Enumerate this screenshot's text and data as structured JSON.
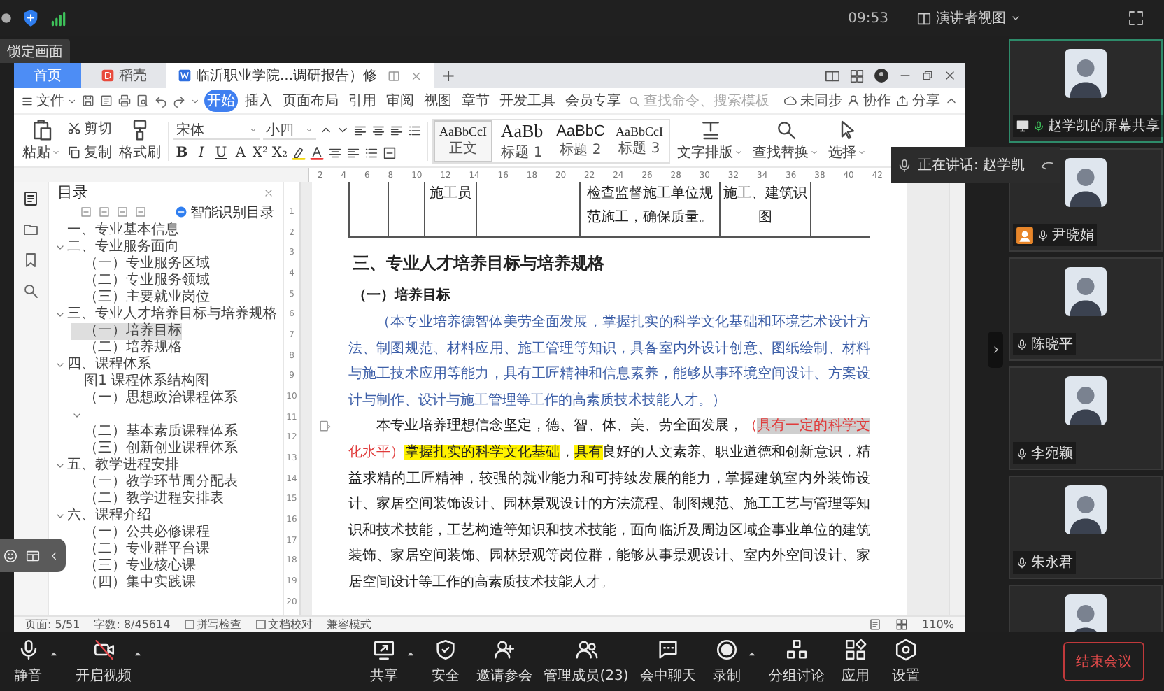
{
  "top_bar": {
    "time": "09:53",
    "view_menu": "演讲者视图"
  },
  "lock_label": "锁定画面",
  "wps": {
    "tabs": [
      {
        "kind": "home",
        "label": "首页",
        "selected": false
      },
      {
        "kind": "docer",
        "label": "稻壳",
        "selected": false
      },
      {
        "kind": "document",
        "label": "临沂职业学院...调研报告）修",
        "selected": true
      }
    ],
    "new_tab": "+",
    "file_menu": "文件",
    "menu_tabs": [
      {
        "label": "开始",
        "selected": true
      },
      {
        "label": "插入",
        "selected": false
      },
      {
        "label": "页面布局",
        "selected": false
      },
      {
        "label": "引用",
        "selected": false
      },
      {
        "label": "审阅",
        "selected": false
      },
      {
        "label": "视图",
        "selected": false
      },
      {
        "label": "章节",
        "selected": false
      },
      {
        "label": "开发工具",
        "selected": false
      },
      {
        "label": "会员专享",
        "selected": false
      }
    ],
    "search": {
      "placeholder": "查找命令、搜索模板"
    },
    "actions": [
      {
        "kind": "sync",
        "label": "未同步"
      },
      {
        "kind": "collab",
        "label": "协作"
      },
      {
        "kind": "share",
        "label": "分享"
      }
    ],
    "ribbon": {
      "clipboard": {
        "paste": "粘贴",
        "cut": "剪切",
        "copy": "复制",
        "format_painter": "格式刷"
      },
      "font": {
        "name": "宋体",
        "size": "小四",
        "glyphs": [
          "B",
          "I",
          "U",
          "A",
          "X²",
          "X₂"
        ]
      },
      "styles": [
        {
          "sample": "AaBbCcI",
          "label": "正文",
          "selected": true
        },
        {
          "sample": "AaBb",
          "label": "标题 1",
          "selected": false
        },
        {
          "sample": "AaBbC",
          "label": "标题 2",
          "selected": false
        },
        {
          "sample": "AaBbCcI",
          "label": "标题 3",
          "selected": false
        }
      ],
      "tools": [
        {
          "kind": "layout",
          "label": "文字排版"
        },
        {
          "kind": "find",
          "label": "查找替换"
        },
        {
          "kind": "select",
          "label": "选择"
        }
      ]
    },
    "ruler": {
      "labels": [
        "2",
        "4",
        "6",
        "8",
        "10",
        "12",
        "14",
        "16",
        "18",
        "20",
        "22",
        "24",
        "26",
        "28",
        "30",
        "32",
        "34",
        "36",
        "38",
        "40",
        "42"
      ]
    },
    "vertical_ruler": {
      "labels": [
        "1",
        "2",
        "3",
        "4",
        "5",
        "6",
        "7",
        "8",
        "9",
        "10",
        "11",
        "12",
        "13",
        "14",
        "15",
        "16",
        "17",
        "18",
        "19",
        "20"
      ]
    },
    "outline": {
      "title": "目录",
      "smart_button": "智能识别目录",
      "items": [
        {
          "label": "一、专业基本信息",
          "selected": false
        },
        {
          "label": "二、专业服务面向",
          "selected": false,
          "expanded": true,
          "children": [
            {
              "label": "（一）专业服务区域",
              "selected": false
            },
            {
              "label": "（二）专业服务领域",
              "selected": false
            },
            {
              "label": "（三）主要就业岗位",
              "selected": false
            }
          ]
        },
        {
          "label": "三、专业人才培养目标与培养规格",
          "selected": false,
          "expanded": true,
          "children": [
            {
              "label": "（一）培养目标",
              "selected": true
            },
            {
              "label": "（二）培养规格",
              "selected": false
            }
          ]
        },
        {
          "label": "四、课程体系",
          "selected": false,
          "expanded": true,
          "children": [
            {
              "label": "图1 课程体系结构图",
              "selected": false
            },
            {
              "label": "（一）思想政治课程体系",
              "selected": false
            },
            {
              "selected": false,
              "expanded": true
            },
            {
              "label": "（二）基本素质课程体系",
              "selected": false
            },
            {
              "label": "（三）创新创业课程体系",
              "selected": false
            }
          ]
        },
        {
          "label": "五、教学进程安排",
          "selected": false,
          "expanded": true,
          "children": [
            {
              "label": "（一）教学环节周分配表",
              "selected": false
            },
            {
              "label": "（二）教学进程安排表",
              "selected": false
            }
          ]
        },
        {
          "label": "六、课程介绍",
          "selected": false,
          "expanded": true,
          "children": [
            {
              "label": "（一）公共必修课程",
              "selected": false
            },
            {
              "label": "（二）专业群平台课",
              "selected": false
            },
            {
              "label": "（三）专业核心课",
              "selected": false
            },
            {
              "label": "（四）集中实践课",
              "selected": false
            }
          ]
        }
      ]
    },
    "document": {
      "table_row": [
        "施工员",
        "检查监督施工单位规范施工，确保质量。",
        "施工、建筑识图"
      ],
      "heading": "三、专业人才培养目标与培养规格",
      "subheading": "（一）培养目标",
      "paragraphs": [
        {
          "runs": [
            {
              "kind": "revision",
              "text": "（本专业培养德智体美劳全面发展，掌握扎实的科学文化基础和环境艺术设计方法、制图规范、材料应用、施工管理等知识，具备室内外设计创意、图纸绘制、材料与施工技术应用等能力，具有工匠精神和信息素养，能够从事环境空间设计、方案设计与制作、设计与施工管理等工作的高素质技术技能人才。）"
            }
          ]
        },
        {
          "runs": [
            {
              "kind": "plain",
              "text": "本专业培养理想信念坚定，德、智、体、美、劳全面发展，"
            },
            {
              "kind": "deleted",
              "text": "（"
            },
            {
              "kind": "deleted_selected",
              "text": "具有一定的科学文"
            },
            {
              "kind": "deleted",
              "text": "化水平）"
            },
            {
              "kind": "highlight",
              "text": "掌握扎实的科学文化基础"
            },
            {
              "kind": "plain",
              "text": "，"
            },
            {
              "kind": "highlight",
              "text": "具有"
            },
            {
              "kind": "plain",
              "text": "良好的人文素养、职业道德和创新意识，精益求精的工匠精神，较强的就业能力和可持续发展的能力，掌握建筑室内外装饰设计、家居空间装饰设计、园林景观设计的方法流程、制图规范、施工工艺与管理等知识和技术技能，工艺构造等知识和技术技能，面向临沂及周边区域企事业单位的建筑装饰、家居空间装饰、园林景观等岗位群，能够从事景观设计、室内外空间设计、家居空间设计等工作的高素质技术技能人才。"
            }
          ]
        }
      ]
    },
    "status_bar": [
      {
        "kind": "text",
        "label": "页面: 5/51"
      },
      {
        "kind": "text",
        "label": "字数: 8/45614"
      },
      {
        "kind": "check",
        "label": "拼写检查"
      },
      {
        "kind": "check",
        "label": "文档校对"
      },
      {
        "kind": "text",
        "label": "兼容模式"
      }
    ],
    "zoom": "110%"
  },
  "speaking": {
    "label": "正在讲话: 赵学凯"
  },
  "participants": [
    {
      "kind": "screen_share",
      "name": "赵学凯的屏幕共享",
      "selected": true,
      "speaking": true
    },
    {
      "kind": "host",
      "name": "尹晓娟",
      "selected": false,
      "speaking": false
    },
    {
      "kind": "member",
      "name": "陈晓平",
      "selected": false,
      "speaking": false
    },
    {
      "kind": "member",
      "name": "李宛颖",
      "selected": false,
      "speaking": false
    },
    {
      "kind": "member",
      "name": "朱永君",
      "selected": false,
      "speaking": false
    },
    {
      "selected": false
    }
  ],
  "toolbar": [
    {
      "kind": "mic",
      "label": "静音",
      "menu": true
    },
    {
      "kind": "video",
      "label": "开启视频",
      "menu": true
    },
    {
      "kind": "share",
      "label": "共享",
      "menu": true
    },
    {
      "kind": "security",
      "label": "安全",
      "menu": false
    },
    {
      "kind": "invite",
      "label": "邀请参会",
      "menu": false
    },
    {
      "kind": "members",
      "label": "管理成员(23)",
      "menu": false
    },
    {
      "kind": "chat",
      "label": "会中聊天",
      "menu": false
    },
    {
      "kind": "record",
      "label": "录制",
      "menu": true
    },
    {
      "kind": "breakout",
      "label": "分组讨论",
      "menu": false
    },
    {
      "kind": "apps",
      "label": "应用",
      "menu": false
    },
    {
      "kind": "settings",
      "label": "设置",
      "menu": false
    }
  ],
  "end_button": "结束会议"
}
